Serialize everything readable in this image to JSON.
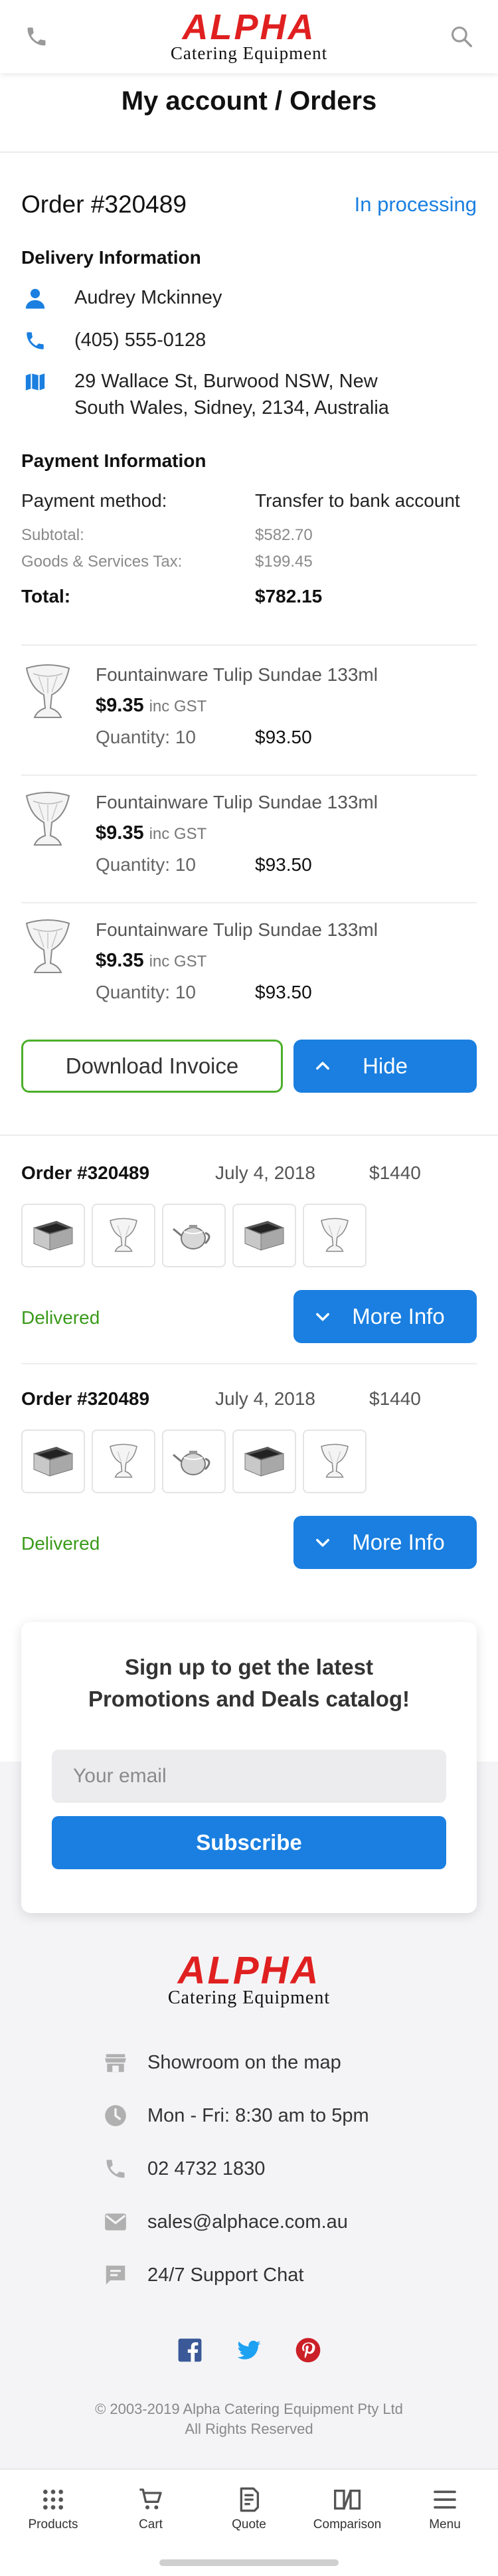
{
  "header": {
    "logo_main": "ALPHA",
    "logo_sub": "Catering Equipment",
    "phone_icon": "phone-icon",
    "search_icon": "search-icon"
  },
  "page_title": "My account / Orders",
  "order": {
    "title": "Order #320489",
    "status": "In processing",
    "delivery": {
      "heading": "Delivery Information",
      "name": "Audrey Mckinney",
      "phone": "(405) 555-0128",
      "address_line1": "29 Wallace St, Burwood NSW, New",
      "address_line2": "South Wales, Sidney, 2134, Australia"
    },
    "payment": {
      "heading": "Payment Information",
      "method_label": "Payment method:",
      "method_value": "Transfer to bank account",
      "subtotal_label": "Subtotal:",
      "subtotal_value": "$582.70",
      "gst_label": "Goods & Services Tax:",
      "gst_value": "$199.45",
      "total_label": "Total:",
      "total_value": "$782.15"
    },
    "products": [
      {
        "name": "Fountainware Tulip Sundae 133ml",
        "price": "$9.35",
        "gst": "inc GST",
        "quantity": "Quantity: 10",
        "line_total": "$93.50"
      },
      {
        "name": "Fountainware Tulip Sundae 133ml",
        "price": "$9.35",
        "gst": "inc GST",
        "quantity": "Quantity: 10",
        "line_total": "$93.50"
      },
      {
        "name": "Fountainware Tulip Sundae 133ml",
        "price": "$9.35",
        "gst": "inc GST",
        "quantity": "Quantity: 10",
        "line_total": "$93.50"
      }
    ],
    "download_label": "Download Invoice",
    "hide_label": "Hide"
  },
  "order_list": [
    {
      "title": "Order #320489",
      "date": "July 4, 2018",
      "price": "$1440",
      "status": "Delivered",
      "more_label": "More Info"
    },
    {
      "title": "Order #320489",
      "date": "July 4, 2018",
      "price": "$1440",
      "status": "Delivered",
      "more_label": "More Info"
    }
  ],
  "newsletter": {
    "title_line1": "Sign up to get the latest",
    "title_line2": "Promotions and Deals catalog!",
    "email_placeholder": "Your email",
    "subscribe_label": "Subscribe"
  },
  "footer": {
    "showroom": "Showroom on the map",
    "hours": "Mon - Fri: 8:30 am to 5pm",
    "phone": "02 4732 1830",
    "email": "sales@alphace.com.au",
    "chat": "24/7 Support Chat",
    "copyright_line1": "© 2003-2019 Alpha Catering Equipment Pty Ltd",
    "copyright_line2": "All Rights Reserved"
  },
  "bottom_nav": [
    {
      "label": "Products",
      "icon": "grid-icon"
    },
    {
      "label": "Cart",
      "icon": "cart-icon"
    },
    {
      "label": "Quote",
      "icon": "quote-icon"
    },
    {
      "label": "Comparison",
      "icon": "comparison-icon"
    },
    {
      "label": "Menu",
      "icon": "menu-icon"
    }
  ],
  "colors": {
    "brand_red": "#e02020",
    "accent_blue": "#1a7fe0",
    "success_green": "#3a9a1a",
    "outline_green": "#4caf2a"
  }
}
